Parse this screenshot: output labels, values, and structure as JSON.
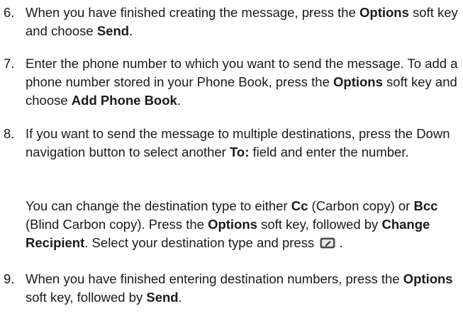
{
  "steps": [
    {
      "number": "6.",
      "paragraphs": [
        [
          {
            "t": "When you have finished creating the message, press the "
          },
          {
            "t": "Options",
            "b": true
          },
          {
            "t": " soft key and choose "
          },
          {
            "t": "Send",
            "b": true
          },
          {
            "t": "."
          }
        ]
      ]
    },
    {
      "number": "7.",
      "paragraphs": [
        [
          {
            "t": "Enter the phone number to which you want to send the message. To add a phone number stored in your Phone Book, press the "
          },
          {
            "t": "Options",
            "b": true
          },
          {
            "t": " soft key and choose "
          },
          {
            "t": "Add Phone Book",
            "b": true
          },
          {
            "t": "."
          }
        ]
      ]
    },
    {
      "number": "8.",
      "paragraphs": [
        [
          {
            "t": "If you want to send the message to multiple destinations, press the Down navigation button to select another "
          },
          {
            "t": "To:",
            "b": true
          },
          {
            "t": " field and enter the number."
          }
        ],
        [
          {
            "t": "You can change the destination type to either "
          },
          {
            "t": "Cc",
            "b": true
          },
          {
            "t": " (Carbon copy) or "
          },
          {
            "t": "Bcc",
            "b": true
          },
          {
            "t": " (Blind Carbon copy). Press the "
          },
          {
            "t": "Options",
            "b": true
          },
          {
            "t": " soft key, followed by "
          },
          {
            "t": "Change Recipient",
            "b": true
          },
          {
            "t": ". Select your destination type and press "
          },
          {
            "icon": "ok-key-icon"
          },
          {
            "t": " ."
          }
        ]
      ]
    },
    {
      "number": "9.",
      "paragraphs": [
        [
          {
            "t": "When you have finished entering destination numbers, press the "
          },
          {
            "t": "Options",
            "b": true
          },
          {
            "t": " soft key, followed by "
          },
          {
            "t": "Send",
            "b": true
          },
          {
            "t": "."
          }
        ]
      ]
    }
  ]
}
